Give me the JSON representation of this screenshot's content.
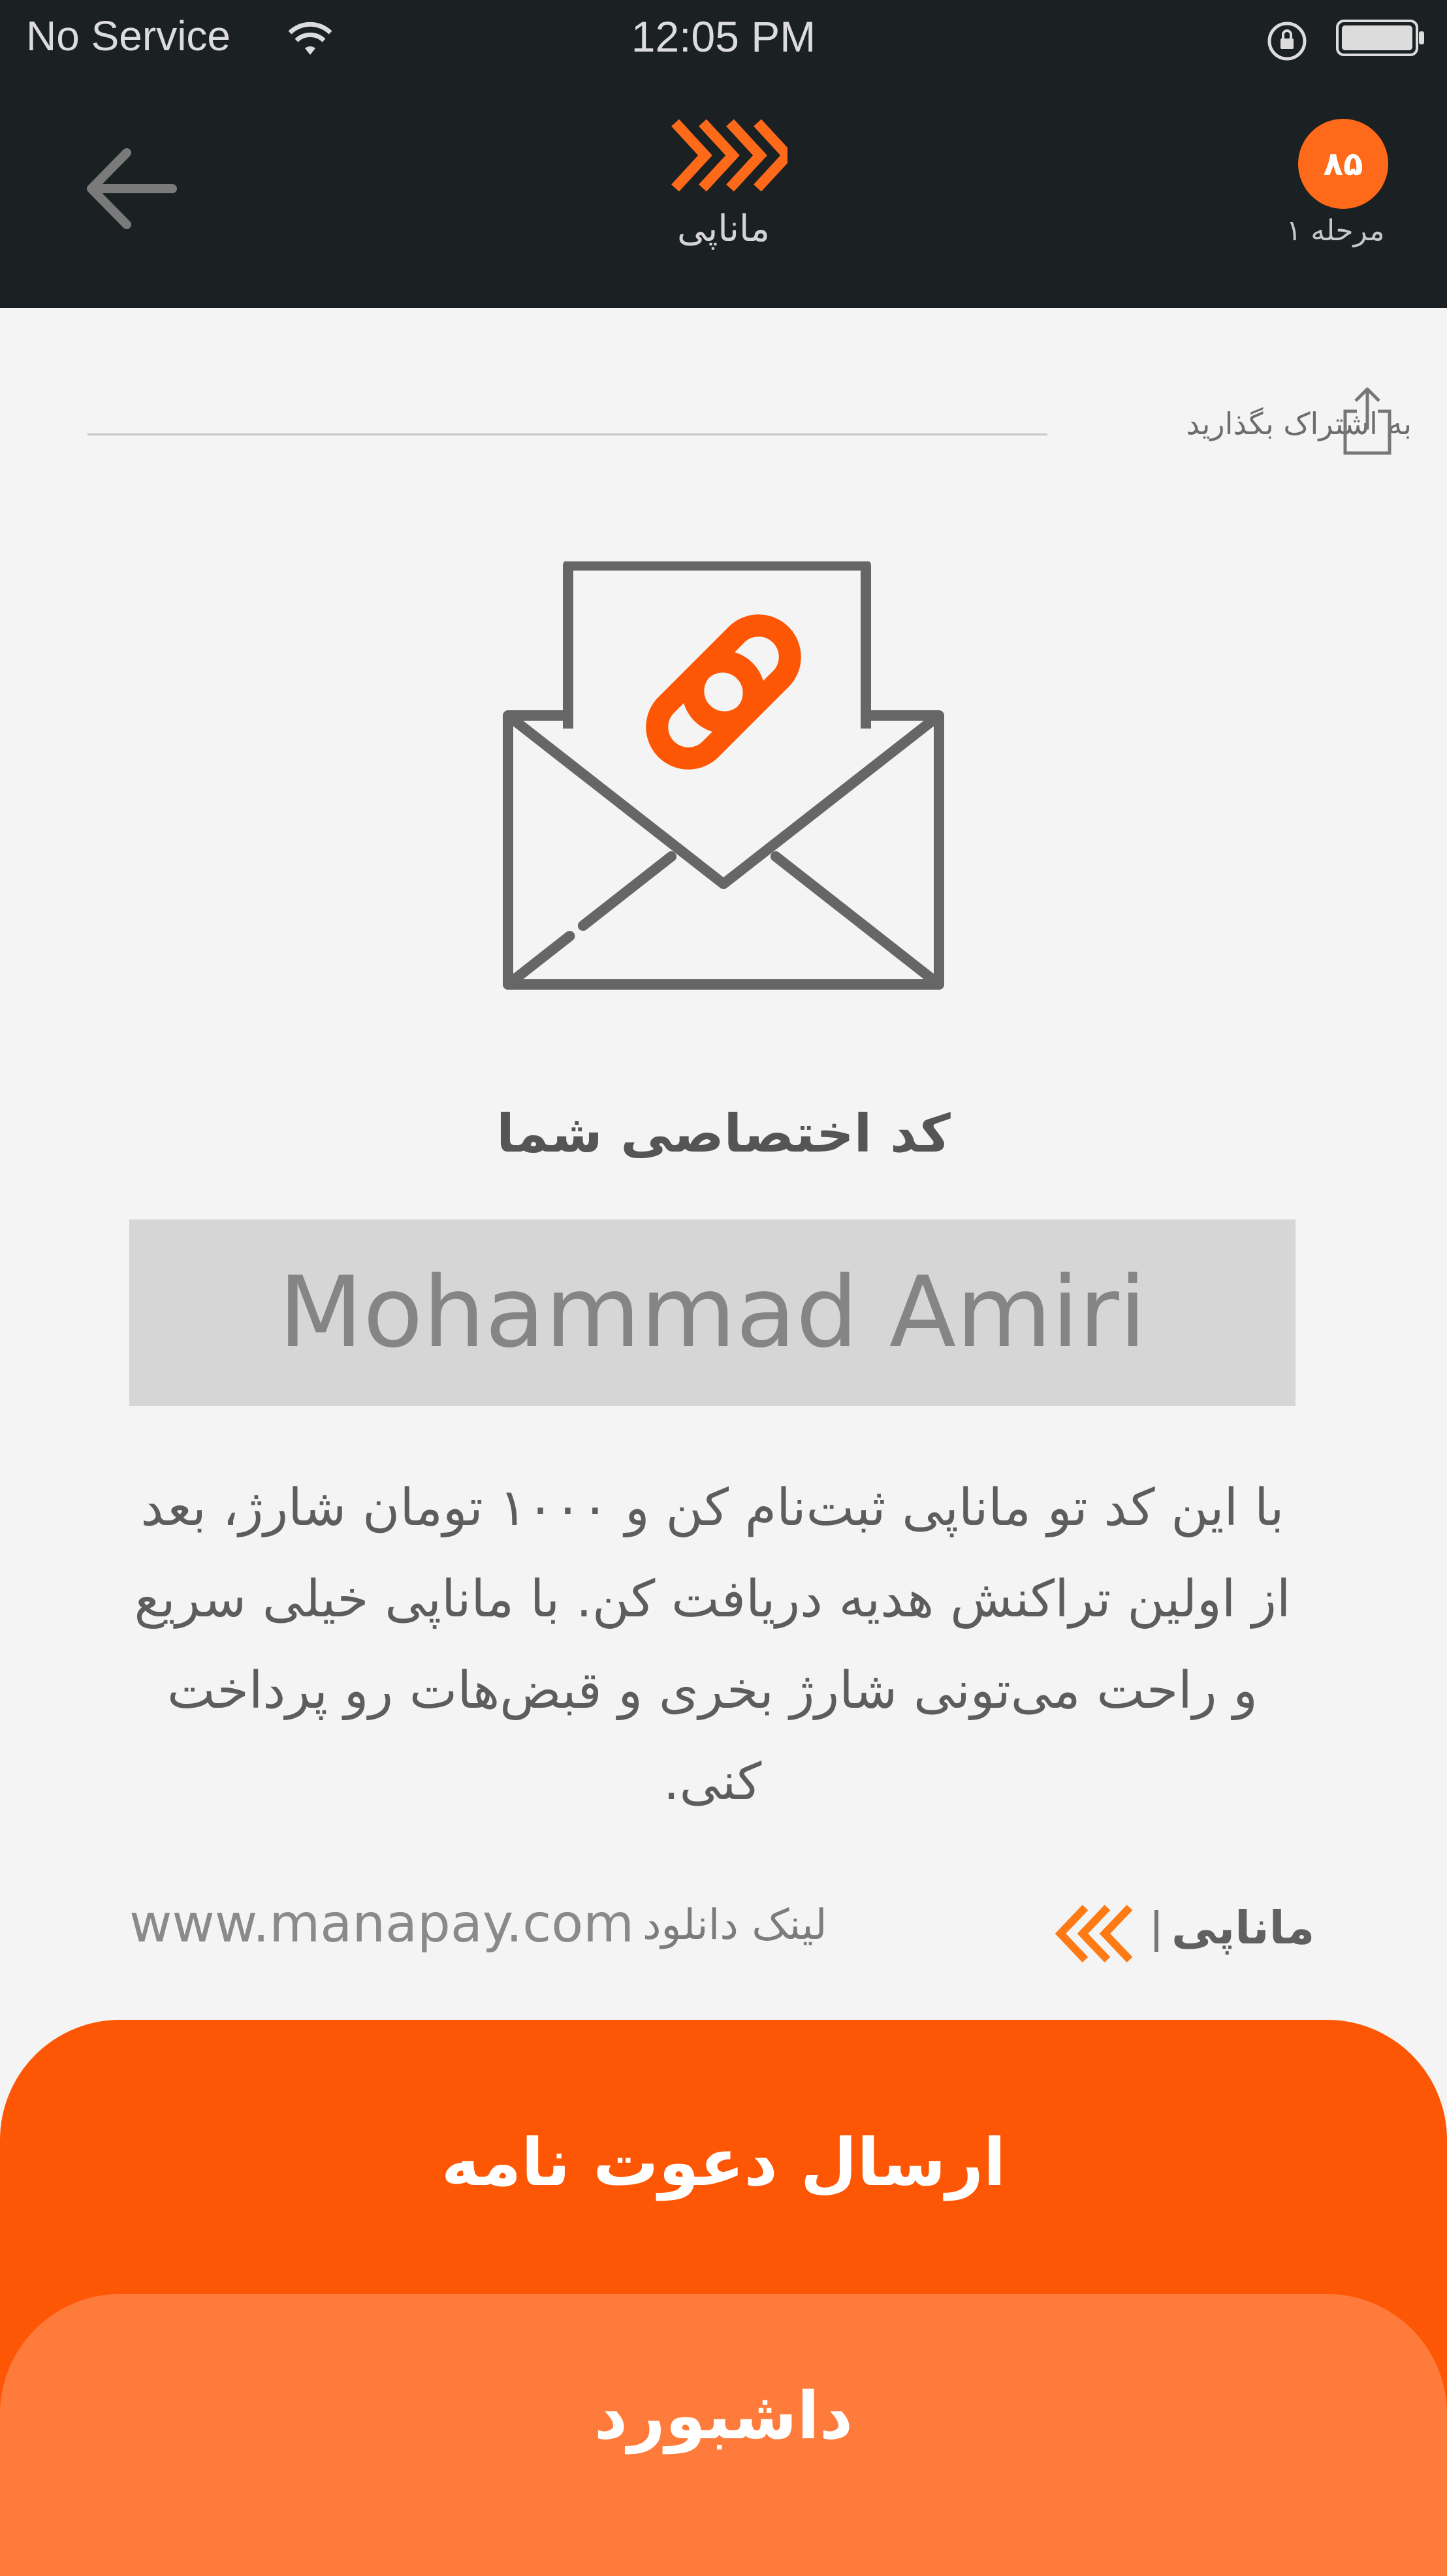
{
  "status_bar": {
    "carrier": "No Service",
    "time": "12:05 PM",
    "icons": [
      "wifi-icon",
      "orientation-lock-icon",
      "battery-icon"
    ]
  },
  "header": {
    "title": "ماناپی",
    "level_value": "۸۵",
    "level_label": "مرحله ۱",
    "icons": [
      "back-arrow-icon",
      "manapay-logo-icon"
    ]
  },
  "share": {
    "label": "به اشتراک بگذارید",
    "icon": "share-icon"
  },
  "illustration": {
    "icon": "envelope-link-icon"
  },
  "code": {
    "title": "کد اختصاصی شما",
    "value": "Mohammad Amiri"
  },
  "description": "با این کد تو ماناپی ثبت‌نام کن و ۱۰۰۰ تومان شارژ، بعد از اولین تراکنش هدیه دریافت کن. با ماناپی خیلی سریع و راحت می‌تونی شارژ بخری و قبض‌هات رو پرداخت کنی.",
  "footer": {
    "url": "www.manapay.com",
    "download_label": "لینک دانلود",
    "brand_name": "ماناپی"
  },
  "actions": {
    "invite_label": "ارسال دعوت نامه",
    "dashboard_label": "داشبورد"
  },
  "colors": {
    "header_bg": "#1b2023",
    "accent": "#fd5705",
    "accent_light": "#ff7b3b",
    "background": "#f4f4f4",
    "code_box": "#d6d6d6"
  }
}
